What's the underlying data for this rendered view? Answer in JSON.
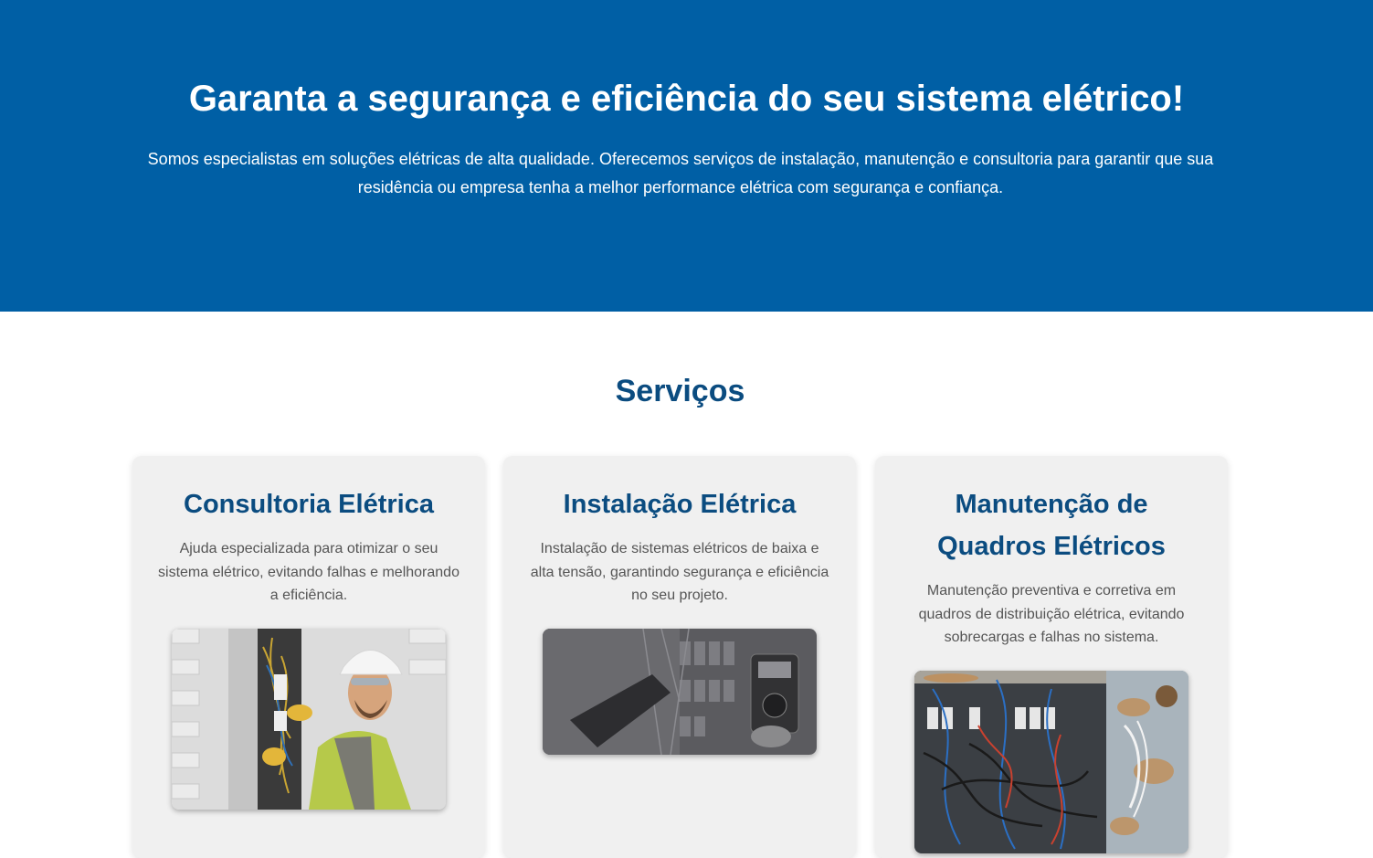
{
  "hero": {
    "title": "Garanta a segurança e eficiência do seu sistema elétrico!",
    "text": "Somos especialistas em soluções elétricas de alta qualidade. Oferecemos serviços de instalação, manutenção e consultoria para garantir que sua residência ou empresa tenha a melhor performance elétrica com segurança e confiança.",
    "background_color": "#005fa5"
  },
  "services": {
    "title": "Serviços",
    "accent_color": "#0b4c80",
    "cards": [
      {
        "title": "Consultoria Elétrica",
        "description": "Ajuda especializada para otimizar o seu sistema elétrico, evitando falhas e melhorando a eficiência.",
        "image": "electrician-worker-photo"
      },
      {
        "title": "Instalação Elétrica",
        "description": "Instalação de sistemas elétricos de baixa e alta tensão, garantindo segurança e eficiência no seu projeto.",
        "image": "multimeter-panel-photo"
      },
      {
        "title": "Manutenção de Quadros Elétricos",
        "description": "Manutenção preventiva e corretiva em quadros de distribuição elétrica, evitando sobrecargas e falhas no sistema.",
        "image": "rusty-electrical-box-photo"
      }
    ]
  }
}
